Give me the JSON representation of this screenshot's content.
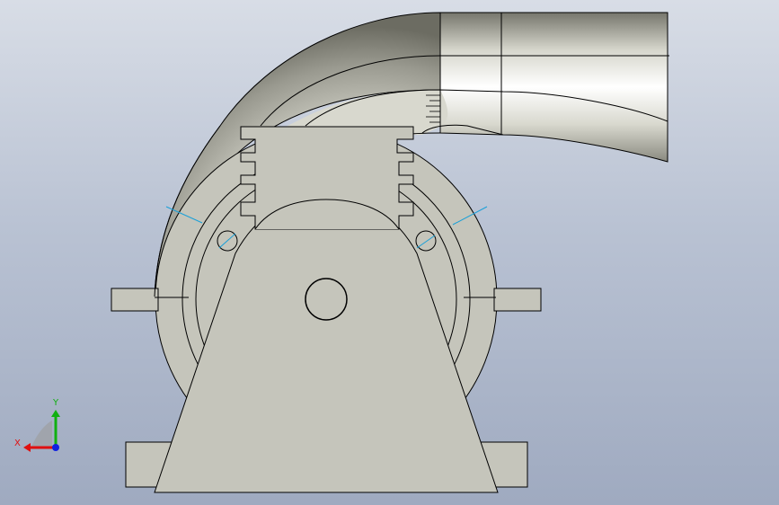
{
  "viewport": {
    "background_top": "#d8dde6",
    "background_bottom": "#9faac0"
  },
  "model": {
    "body_color": "#c5c5bb",
    "edge_color": "#000000",
    "sketch_line_color": "#1aa0d8"
  },
  "triad": {
    "x_label": "X",
    "y_label": "Y",
    "x_color": "#e01010",
    "y_color": "#10b010",
    "z_color": "#1020e0"
  }
}
